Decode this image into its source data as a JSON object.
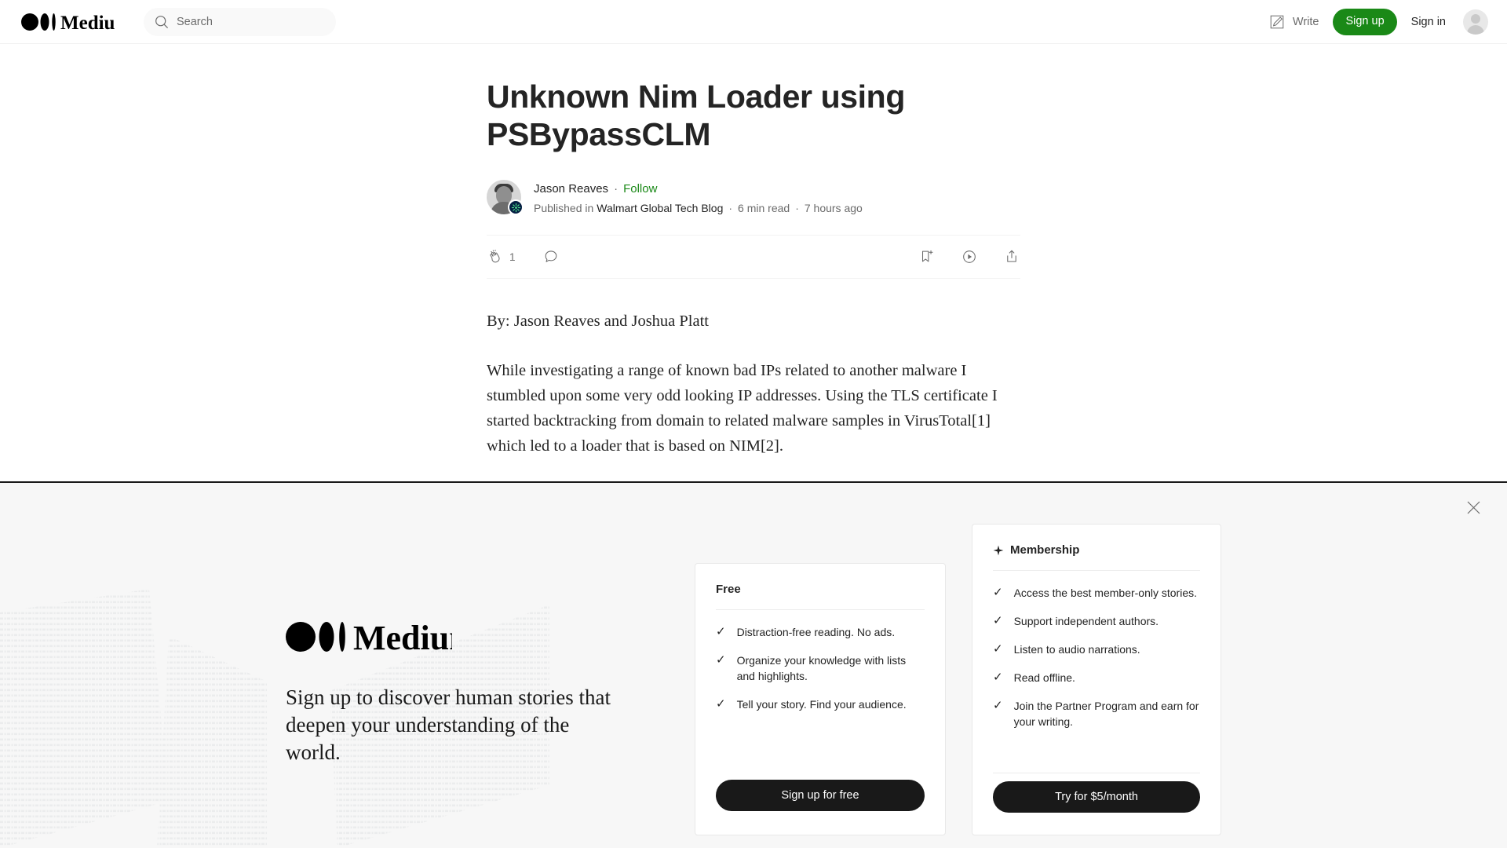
{
  "header": {
    "logo_text": "Medium",
    "search": {
      "placeholder": "Search",
      "value": "",
      "icon": "search-icon"
    },
    "write_label": "Write",
    "write_icon": "pencil-square-icon",
    "signup_label": "Sign up",
    "signin_label": "Sign in",
    "avatar_icon": "user-avatar-icon",
    "signup_color": "#1a8917"
  },
  "article": {
    "title": "Unknown Nim Loader using PSBypassCLM",
    "author": "Jason Reaves",
    "separator": "·",
    "follow_label": "Follow",
    "published_prefix": "Published in",
    "publication": "Walmart Global Tech Blog",
    "read_time": "6 min read",
    "published_ago": "7 hours ago",
    "avatar_icon": "author-avatar-icon",
    "publication_badge_icon": "walmart-spark-icon",
    "actions": {
      "clap_icon": "clap-icon",
      "clap_count": "1",
      "comment_icon": "comment-icon",
      "bookmark_icon": "bookmark-add-icon",
      "listen_icon": "play-circle-icon",
      "share_icon": "share-icon"
    },
    "paragraphs": [
      "By: Jason Reaves and Joshua Platt",
      "While investigating a range of known bad IPs related to another malware I stumbled upon some very odd looking IP addresses. Using the TLS certificate I started backtracking from domain to related malware samples in VirusTotal[1] which led to a loader that is based on NIM[2]."
    ]
  },
  "banner": {
    "close_icon": "close-icon",
    "logo_text": "Medium",
    "tagline": "Sign up to discover human stories that deepen your understanding of the world.",
    "free_card": {
      "title": "Free",
      "features": [
        "Distraction-free reading. No ads.",
        "Organize your knowledge with lists and highlights.",
        "Tell your story. Find your audience."
      ],
      "cta_label": "Sign up for free"
    },
    "membership_card": {
      "title": "Membership",
      "title_icon": "sparkle-icon",
      "features": [
        "Access the best member-only stories.",
        "Support independent authors.",
        "Listen to audio narrations.",
        "Read offline.",
        "Join the Partner Program and earn for your writing."
      ],
      "cta_label": "Try for $5/month"
    },
    "check_glyph": "✓"
  }
}
